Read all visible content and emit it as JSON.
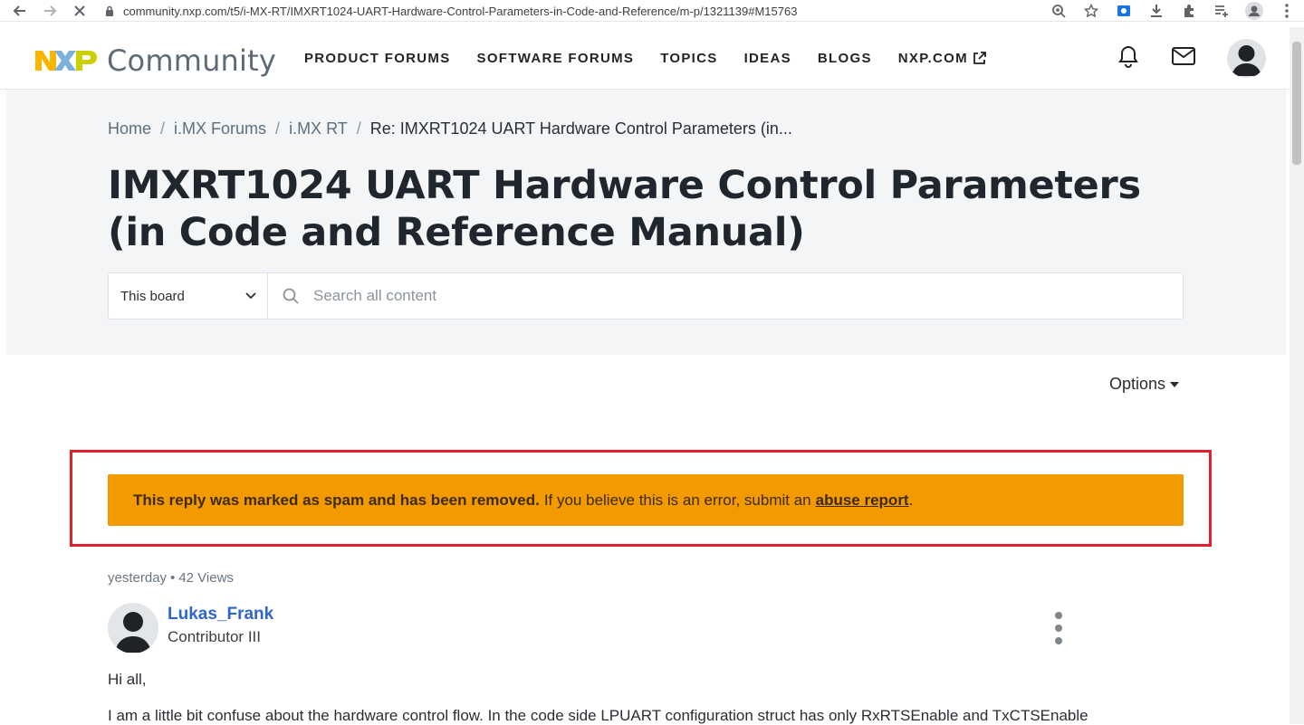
{
  "browser": {
    "url": "community.nxp.com/t5/i-MX-RT/IMXRT1024-UART-Hardware-Control-Parameters-in-Code-and-Reference/m-p/1321139#M15763"
  },
  "header": {
    "logo_text": "Community",
    "nav": [
      {
        "label": "PRODUCT FORUMS"
      },
      {
        "label": "SOFTWARE FORUMS"
      },
      {
        "label": "TOPICS"
      },
      {
        "label": "IDEAS"
      },
      {
        "label": "BLOGS"
      },
      {
        "label": "NXP.COM"
      }
    ]
  },
  "breadcrumb": {
    "items": [
      "Home",
      "i.MX Forums",
      "i.MX RT"
    ],
    "separator": "/",
    "current": "Re: IMXRT1024 UART Hardware Control Parameters (in..."
  },
  "page": {
    "title": "IMXRT1024 UART Hardware Control Parameters (in Code and Reference Manual)"
  },
  "search": {
    "scope": "This board",
    "placeholder": "Search all content"
  },
  "options_label": "Options",
  "spam_notice": {
    "bold": "This reply was marked as spam and has been removed.",
    "text": "If you believe this is an error, submit an",
    "link": "abuse report",
    "end": "."
  },
  "post": {
    "time": "yesterday",
    "dot": "•",
    "views": "42 Views",
    "author": "Lukas_Frank",
    "rank": "Contributor III",
    "greeting": "Hi all,",
    "body": "I am a little bit confuse about the hardware control flow. In the code side LPUART configuration struct has only RxRTSEnable and TxCTSEnable"
  },
  "colors": {
    "banner": "#f39a00",
    "highlight": "#e0202b",
    "link": "#2f66c9"
  }
}
